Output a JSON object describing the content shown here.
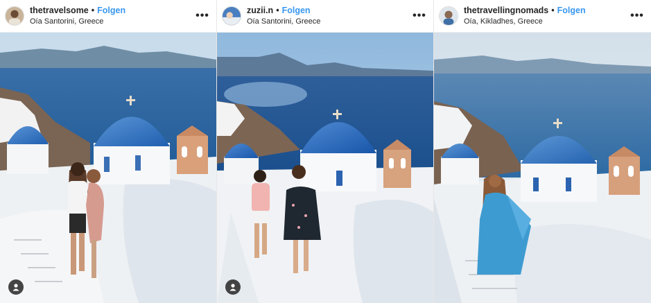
{
  "posts": [
    {
      "username": "thetravelsome",
      "follow_label": "Folgen",
      "separator": "•",
      "location": "Oía Santorini, Greece",
      "more_icon": "more-options-icon",
      "tag_icon": "user-tag-icon",
      "has_tag": true
    },
    {
      "username": "zuzii.n",
      "follow_label": "Folgen",
      "separator": "•",
      "location": "Oía Santorini, Greece",
      "more_icon": "more-options-icon",
      "tag_icon": "user-tag-icon",
      "has_tag": true
    },
    {
      "username": "thetravellingnomads",
      "follow_label": "Folgen",
      "separator": "•",
      "location": "Oía, Kikladhes, Greece",
      "more_icon": "more-options-icon",
      "has_tag": false
    }
  ],
  "colors": {
    "follow_blue": "#3897f0",
    "dome_blue": "#2f6fc4",
    "sea_blue": "#2a5f9e",
    "sky": "#cfe0ef"
  }
}
